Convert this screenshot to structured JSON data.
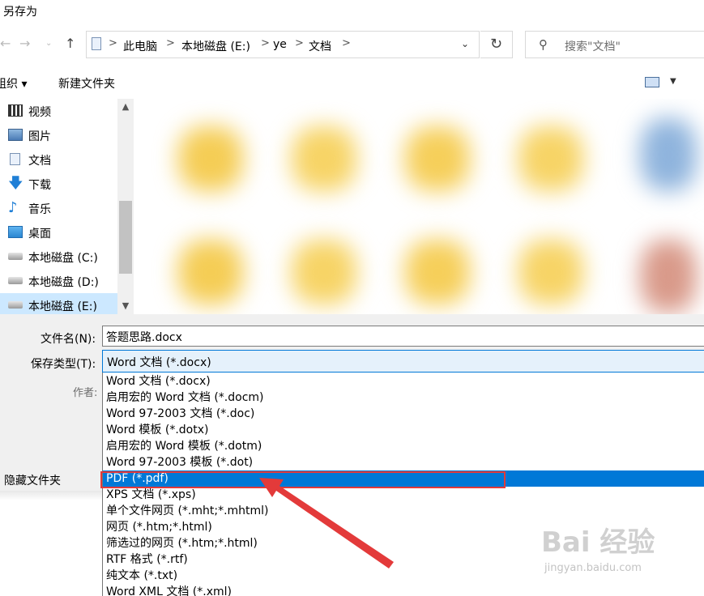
{
  "window": {
    "title": "另存为"
  },
  "address": {
    "breadcrumbs": [
      "此电脑",
      "本地磁盘 (E:)",
      "ye",
      "文档"
    ],
    "separator": ">"
  },
  "search": {
    "placeholder": "搜索\"文档\""
  },
  "toolbar": {
    "organize_label": "组织 ▾",
    "new_folder_label": "新建文件夹"
  },
  "nav": {
    "items": [
      {
        "label": "视频",
        "icon": "video-icon"
      },
      {
        "label": "图片",
        "icon": "picture-icon"
      },
      {
        "label": "文档",
        "icon": "document-icon"
      },
      {
        "label": "下载",
        "icon": "download-icon"
      },
      {
        "label": "音乐",
        "icon": "music-icon"
      },
      {
        "label": "桌面",
        "icon": "desktop-icon"
      },
      {
        "label": "本地磁盘 (C:)",
        "icon": "drive-icon"
      },
      {
        "label": "本地磁盘 (D:)",
        "icon": "drive-icon"
      },
      {
        "label": "本地磁盘 (E:)",
        "icon": "drive-icon"
      }
    ],
    "selected_index": 8
  },
  "form": {
    "filename_label": "文件名(N):",
    "filename_value": "答题思路.docx",
    "filetype_label": "保存类型(T):",
    "filetype_value": "Word 文档 (*.docx)",
    "author_label": "作者:",
    "hidden_folders_label": "隐藏文件夹"
  },
  "filetype_options": [
    "Word 文档 (*.docx)",
    "启用宏的 Word 文档 (*.docm)",
    "Word 97-2003 文档 (*.doc)",
    "Word 模板 (*.dotx)",
    "启用宏的 Word 模板 (*.dotm)",
    "Word 97-2003 模板 (*.dot)",
    "PDF (*.pdf)",
    "XPS 文档 (*.xps)",
    "单个文件网页 (*.mht;*.mhtml)",
    "网页 (*.htm;*.html)",
    "筛选过的网页 (*.htm;*.html)",
    "RTF 格式 (*.rtf)",
    "纯文本 (*.txt)",
    "Word XML 文档 (*.xml)"
  ],
  "selected_option_index": 6,
  "annotation": {
    "color": "#e33a3a"
  },
  "watermark": {
    "logo": "Bai 经验",
    "url": "jingyan.baidu.com"
  },
  "colors": {
    "selection": "#0078d7",
    "nav_selected": "#cce8ff",
    "form_bg": "#f0f0f0"
  }
}
